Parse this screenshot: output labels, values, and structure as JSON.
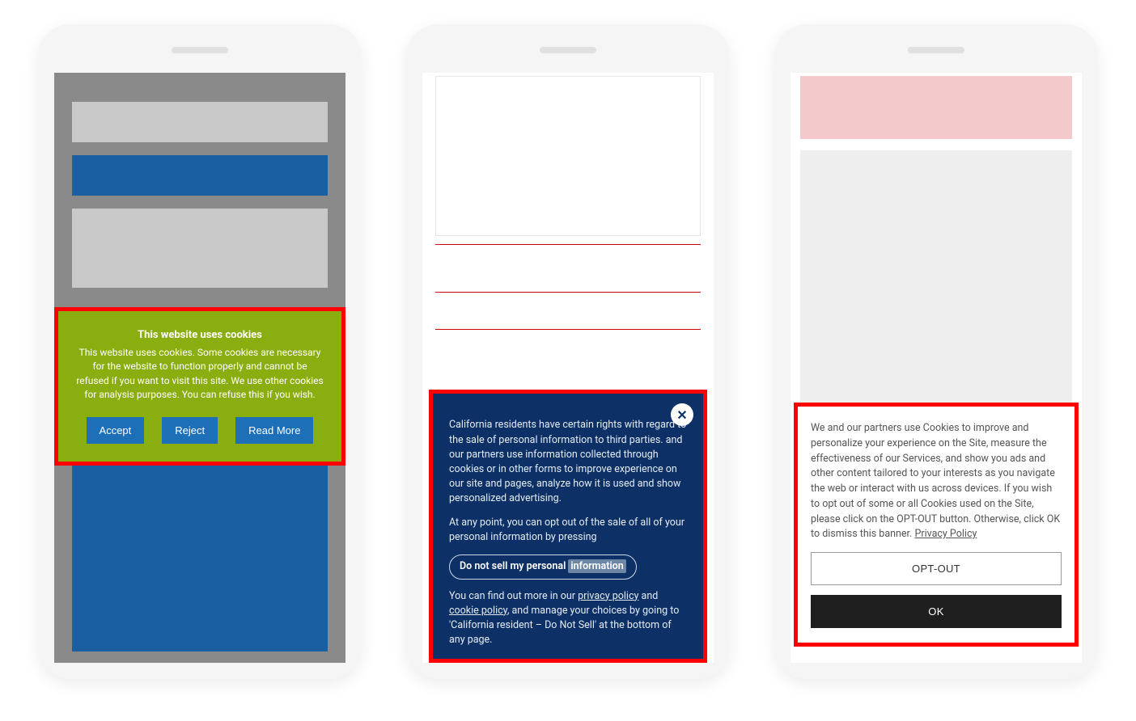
{
  "phone1": {
    "dialog": {
      "title": "This website uses cookies",
      "text": "This website uses cookies. Some cookies are necessary for the website to function properly and cannot be refused if you want to visit this site. We use other cookies for analysis purposes. You can refuse this if you wish.",
      "accept": "Accept",
      "reject": "Reject",
      "readmore": "Read More"
    }
  },
  "phone2": {
    "dialog": {
      "para1_a": "California residents have certain rights with regard to the sale of personal information to third parties. ",
      "para1_b": " and our partners use information collected through cookies or in other forms to improve experience on our site and pages, analyze how it is used and show personalized advertising.",
      "para2": "At any point, you can opt out of the sale of all of your personal information by pressing",
      "pill_a": "Do not sell my personal ",
      "pill_b": "information",
      "para3_a": "You can find out more in our ",
      "link_privacy": "privacy policy",
      "and": " and ",
      "link_cookie": "cookie policy",
      "para3_b": ", and manage your choices by going to 'California resident – Do Not Sell' at the bottom of any page."
    }
  },
  "phone3": {
    "dialog": {
      "text_a": "We and our partners use Cookies to improve and personalize your experience on the Site, measure the effectiveness of our Services, and show you ads and other content tailored to your interests as you navigate the web or interact with us across devices. If you wish to opt out of some or all Cookies used on the Site, please click on the OPT-OUT button. Otherwise, click OK to dismiss this banner. ",
      "link_privacy": "Privacy Policy",
      "optout": "OPT-OUT",
      "ok": "OK"
    }
  }
}
